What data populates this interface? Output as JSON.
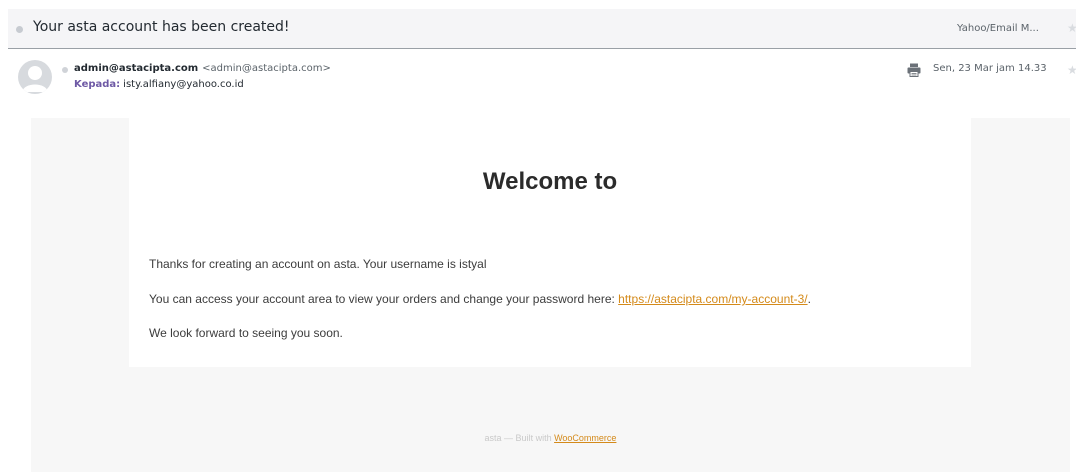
{
  "subject": {
    "text": "Your asta account has been created!",
    "folder": "Yahoo/Email M..."
  },
  "sender": {
    "name": "admin@astacipta.com",
    "email": "<admin@astacipta.com>",
    "to_label": "Kepada:",
    "to_value": "isty.alfiany@yahoo.co.id",
    "date": "Sen, 23 Mar jam 14.33"
  },
  "email_body": {
    "heading": "Welcome to",
    "line1": "Thanks for creating an account on asta. Your username is istyal",
    "line2_prefix": "You can access your account area to view your orders and change your password here: ",
    "line2_link": "https://astacipta.com/my-account-3/",
    "line2_suffix": ".",
    "line3": "We look forward to seeing you soon.",
    "footer_prefix": "asta — Built with ",
    "footer_link": "WooCommerce"
  },
  "icons": {
    "subject_star": "star-icon",
    "sender_star": "star-icon",
    "print": "printer-icon",
    "avatar": "user-avatar-icon"
  },
  "colors": {
    "link": "#d48a1a",
    "to_label": "#6e59a5",
    "body_bg": "#f7f7f7"
  }
}
